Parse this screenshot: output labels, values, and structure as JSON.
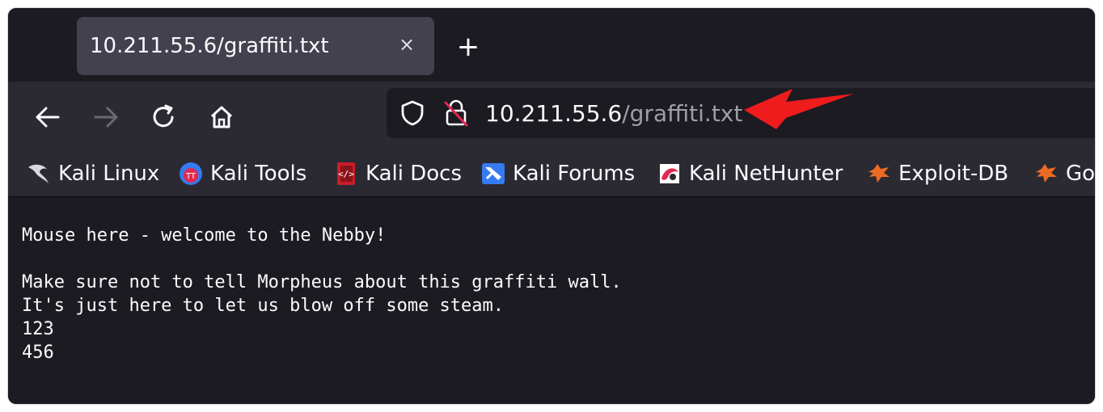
{
  "tab": {
    "title": "10.211.55.6/graffiti.txt",
    "close": "×"
  },
  "new_tab": "+",
  "url": {
    "host": "10.211.55.6",
    "path": "/graffiti.txt"
  },
  "bookmarks": [
    {
      "label": "Kali Linux",
      "icon": "kali-dragon-icon"
    },
    {
      "label": "Kali Tools",
      "icon": "kali-tools-icon"
    },
    {
      "label": "Kali Docs",
      "icon": "kali-docs-icon"
    },
    {
      "label": "Kali Forums",
      "icon": "kali-forums-icon"
    },
    {
      "label": "Kali NetHunter",
      "icon": "nethunter-icon"
    },
    {
      "label": "Exploit-DB",
      "icon": "exploit-db-icon"
    },
    {
      "label": "Go",
      "icon": "ghdb-icon"
    }
  ],
  "content": {
    "lines": [
      "Mouse here - welcome to the Nebby!",
      "",
      "Make sure not to tell Morpheus about this graffiti wall.",
      "It's just here to let us blow off some steam.",
      "123",
      "456"
    ]
  },
  "colors": {
    "annotation_arrow": "#ee1c1c",
    "content_bg": "#1c1b22",
    "toolbar_bg": "#2b2a33"
  }
}
